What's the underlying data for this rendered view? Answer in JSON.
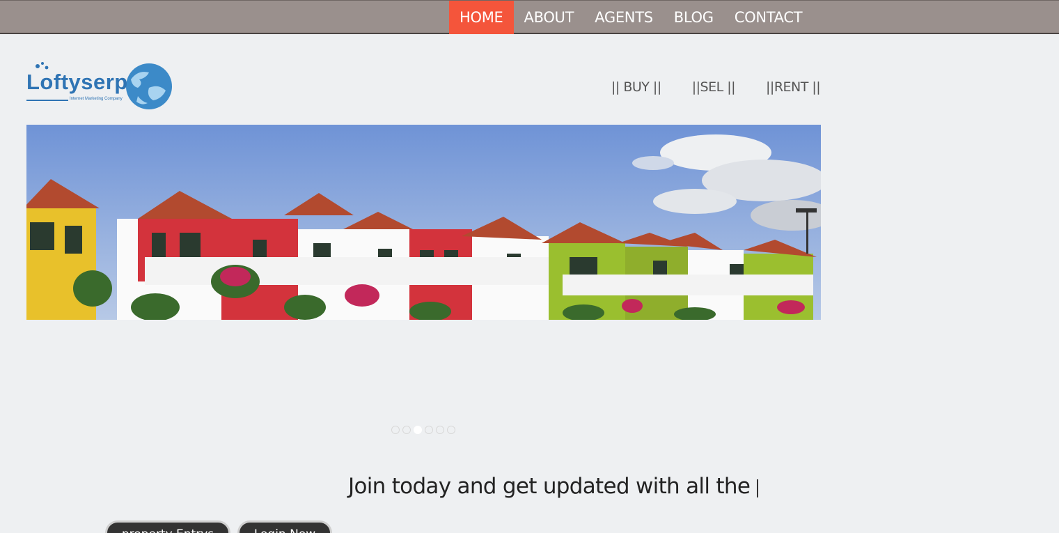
{
  "top_nav": {
    "items": [
      {
        "label": "HOME",
        "active": true
      },
      {
        "label": "ABOUT"
      },
      {
        "label": "AGENTS"
      },
      {
        "label": "BLOG"
      },
      {
        "label": "CONTACT"
      }
    ]
  },
  "logo": {
    "text": "Loftyserp",
    "subtitle": "Internet Marketing Company"
  },
  "sub_nav": {
    "buy": "|| BUY ||",
    "sel": "||SEL ||",
    "rent": "||RENT ||"
  },
  "slider": {
    "dot_count": 6,
    "active_index": 2
  },
  "tagline": "Join today and get updated with all the",
  "buttons": {
    "entry": "property Entrys",
    "login": "Login Now"
  },
  "colors": {
    "topbar": "#9a908d",
    "active_nav": "#f4553b",
    "logo_blue": "#2f74b4"
  }
}
